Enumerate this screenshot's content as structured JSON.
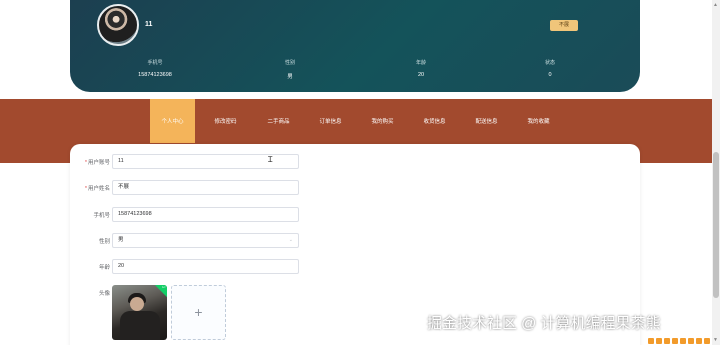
{
  "profile": {
    "username": "11",
    "status_badge": "不展",
    "fields": [
      {
        "label": "手机号",
        "value": "15874123698"
      },
      {
        "label": "性别",
        "value": "男"
      },
      {
        "label": "年龄",
        "value": "20"
      },
      {
        "label": "状态",
        "value": "0"
      }
    ]
  },
  "nav": {
    "items": [
      "个人中心",
      "修改密码",
      "二手商品",
      "订单信息",
      "我的购买",
      "收货信息",
      "配送信息",
      "我的收藏"
    ],
    "active_index": 0
  },
  "form": {
    "account": {
      "label": "用户账号",
      "value": "11",
      "required": "*"
    },
    "name": {
      "label": "用户姓名",
      "value": "不展",
      "required": "*"
    },
    "phone": {
      "label": "手机号",
      "value": "15874123698"
    },
    "gender": {
      "label": "性别",
      "value": "男"
    },
    "age": {
      "label": "年龄",
      "value": "20"
    },
    "avatar": {
      "label": "头像",
      "upload_symbol": "+"
    }
  },
  "watermark": "掘金技术社区 @ 计算机编程果茶熊",
  "colors": {
    "header_bg": "#14535a",
    "nav_bg": "#a24a2e",
    "nav_active": "#f4b45a",
    "badge": "#f0c57a"
  },
  "icons": {
    "cursor": "text-cursor-icon",
    "select_arrow": "chevron-down-icon",
    "upload": "plus-icon",
    "uploaded": "check-icon"
  }
}
